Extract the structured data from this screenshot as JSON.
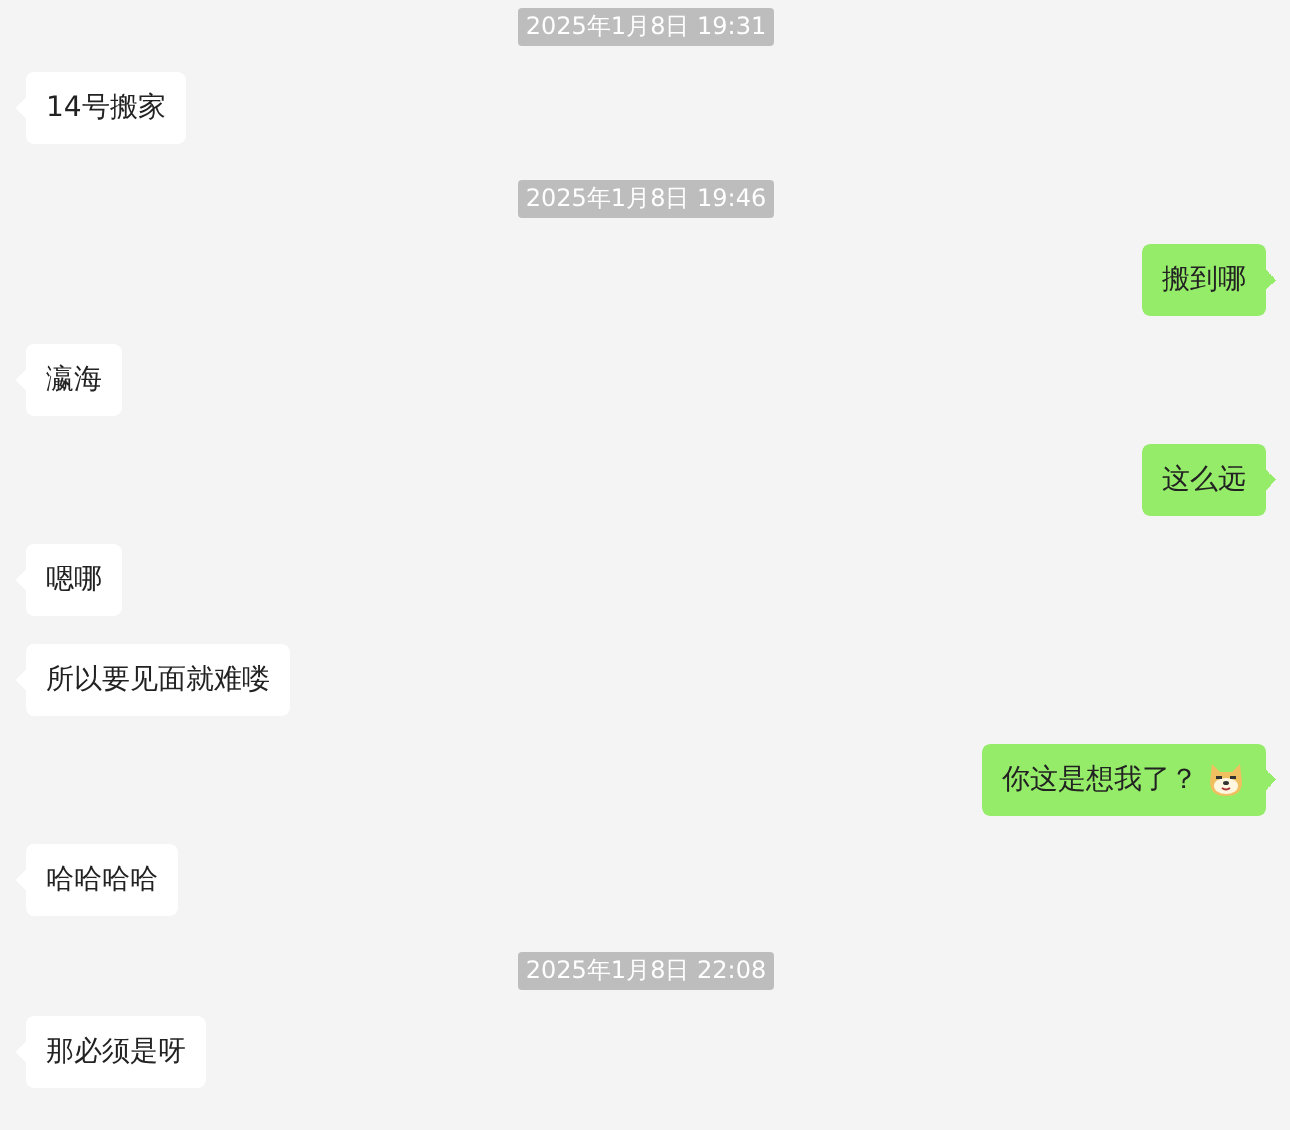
{
  "messages": [
    {
      "kind": "time",
      "text": "2025年1月8日 19:31"
    },
    {
      "kind": "in",
      "text": "14号搬家"
    },
    {
      "kind": "time",
      "text": "2025年1月8日 19:46"
    },
    {
      "kind": "out",
      "text": "搬到哪"
    },
    {
      "kind": "in",
      "text": "瀛海"
    },
    {
      "kind": "out",
      "text": "这么远"
    },
    {
      "kind": "in",
      "text": "嗯哪"
    },
    {
      "kind": "in",
      "text": "所以要见面就难喽"
    },
    {
      "kind": "out",
      "text": "你这是想我了？",
      "emoji": true
    },
    {
      "kind": "in",
      "text": "哈哈哈哈"
    },
    {
      "kind": "time",
      "text": "2025年1月8日 22:08"
    },
    {
      "kind": "in",
      "text": "那必须是呀"
    }
  ]
}
